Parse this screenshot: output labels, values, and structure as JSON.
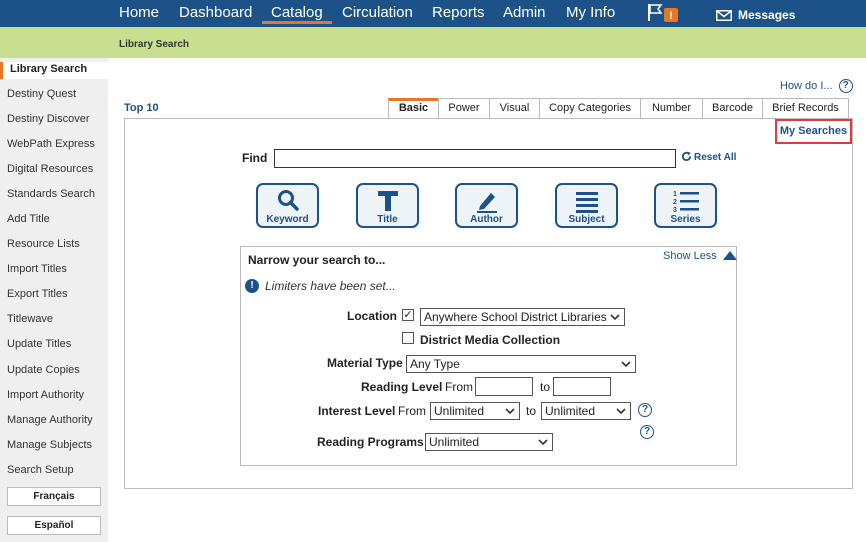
{
  "topnav": {
    "items": [
      "Home",
      "Dashboard",
      "Catalog",
      "Circulation",
      "Reports",
      "Admin",
      "My Info"
    ],
    "active": "Catalog",
    "flag_badge": "!",
    "messages": "Messages"
  },
  "breadcrumb": "Library Search",
  "sidebar": {
    "items": [
      "Library Search",
      "Destiny Quest",
      "Destiny Discover",
      "WebPath Express",
      "Digital Resources",
      "Standards Search",
      "Add Title",
      "Resource Lists",
      "Import Titles",
      "Export Titles",
      "Titlewave",
      "Update Titles",
      "Update Copies",
      "Import Authority",
      "Manage Authority",
      "Manage Subjects",
      "Search Setup"
    ],
    "active": "Library Search",
    "languages": [
      "Français",
      "Español"
    ]
  },
  "main": {
    "how_do_i": "How do I...",
    "help": "?",
    "top10": "Top 10",
    "tabs": [
      "Basic",
      "Power",
      "Visual",
      "Copy Categories",
      "Number",
      "Barcode",
      "Brief Records"
    ],
    "active_tab": "Basic",
    "my_searches": "My Searches",
    "find_label": "Find",
    "find_value": "",
    "reset_all": "Reset All",
    "search_buttons": [
      "Keyword",
      "Title",
      "Author",
      "Subject",
      "Series"
    ],
    "narrow": {
      "title": "Narrow your search to...",
      "show_less": "Show Less",
      "limiters_note": "Limiters have been set...",
      "location_label": "Location",
      "location_checked": true,
      "location_value": "Anywhere School District Libraries",
      "district_label": "District Media Collection",
      "district_checked": false,
      "material_type_label": "Material Type",
      "material_type_value": "Any Type",
      "reading_level_label": "Reading Level",
      "from_label": "From",
      "to_label": "to",
      "interest_level_label": "Interest Level",
      "interest_from": "Unlimited",
      "interest_to": "Unlimited",
      "reading_programs_label": "Reading Programs",
      "reading_programs_value": "Unlimited"
    }
  },
  "colors": {
    "nav": "#1c5288",
    "accent": "#e87722",
    "subbar": "#c8df8f",
    "highlight": "#e03a3a"
  }
}
